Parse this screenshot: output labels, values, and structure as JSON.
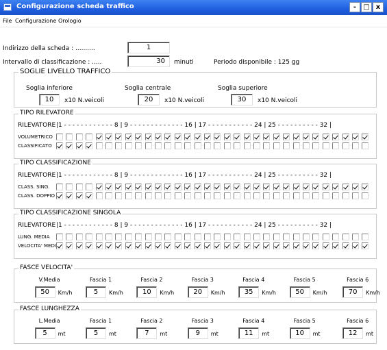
{
  "window": {
    "title": "Configurazione scheda traffico",
    "minimize": "-",
    "maximize": "□",
    "close": "x"
  },
  "menu": [
    "File",
    "Configurazione",
    "Orologio"
  ],
  "board": {
    "address_label": "Indirizzo della scheda : ..........",
    "address_value": "1",
    "interval_label": "Intervallo di classificazione : .....",
    "interval_value": "30",
    "interval_unit": "minuti",
    "period_label": "Periodo disponibile : 125 gg"
  },
  "thresholds": {
    "title": "SOGLIE LIVELLO TRAFFICO",
    "items": [
      {
        "label": "Soglia inferiore",
        "value": "10",
        "unit": "x10 N.veicoli"
      },
      {
        "label": "Soglia centrale",
        "value": "20",
        "unit": "x10 N.veicoli"
      },
      {
        "label": "Soglia superiore",
        "value": "30",
        "unit": "x10 N.veicoli"
      }
    ]
  },
  "scale_text": "|1 - - - - - - - - - - - - 8 | 9 - - - - - - - - - - - - - 16 | 17 - - - - - - - - - - - 24 | 25 - - - - - - - - - - 32 |",
  "sensor_groups": [
    {
      "title": "TIPO RILEVATORE",
      "header": "RILEVATORE",
      "rows": [
        {
          "label": "VOLUMETRICO",
          "checked": [
            false,
            false,
            false,
            false,
            true,
            true,
            true,
            true,
            true,
            true,
            true,
            true,
            true,
            true,
            true,
            true,
            true,
            true,
            true,
            true,
            true,
            true,
            true,
            true,
            true,
            true,
            true,
            true,
            true,
            true,
            true,
            true
          ]
        },
        {
          "label": "CLASSIFICATO",
          "checked": [
            true,
            true,
            true,
            true,
            false,
            false,
            false,
            false,
            false,
            false,
            false,
            false,
            false,
            false,
            false,
            false,
            false,
            false,
            false,
            false,
            false,
            false,
            false,
            false,
            false,
            false,
            false,
            false,
            false,
            false,
            false,
            false
          ]
        }
      ]
    },
    {
      "title": "TIPO CLASSIFICAZIONE",
      "header": "RILEVATORE",
      "rows": [
        {
          "label": "CLASS. SING.",
          "checked": [
            false,
            false,
            false,
            false,
            true,
            true,
            true,
            true,
            true,
            true,
            true,
            true,
            true,
            true,
            true,
            true,
            true,
            true,
            true,
            true,
            true,
            true,
            true,
            true,
            true,
            true,
            true,
            true,
            true,
            true,
            true,
            true
          ]
        },
        {
          "label": "CLASS. DOPPIO",
          "checked": [
            true,
            true,
            true,
            true,
            false,
            false,
            false,
            false,
            false,
            false,
            false,
            false,
            false,
            false,
            false,
            false,
            false,
            false,
            false,
            false,
            false,
            false,
            false,
            false,
            false,
            false,
            false,
            false,
            false,
            false,
            false,
            false
          ]
        }
      ]
    },
    {
      "title": "TIPO CLASSIFICAZIONE SINGOLA",
      "header": "RILEVATORE",
      "rows": [
        {
          "label": "LUNG. MEDIA",
          "checked": [
            false,
            false,
            false,
            false,
            false,
            false,
            false,
            false,
            false,
            false,
            false,
            false,
            false,
            false,
            false,
            false,
            false,
            false,
            false,
            false,
            false,
            false,
            false,
            false,
            false,
            false,
            false,
            false,
            false,
            false,
            false,
            false
          ]
        },
        {
          "label": "VELOCITA' MEDIA",
          "checked": [
            true,
            true,
            true,
            true,
            true,
            true,
            true,
            true,
            true,
            true,
            true,
            true,
            true,
            true,
            true,
            true,
            true,
            true,
            true,
            true,
            true,
            true,
            true,
            true,
            true,
            true,
            true,
            true,
            true,
            true,
            true,
            true
          ]
        }
      ]
    }
  ],
  "speed_bands": {
    "title": "FASCE VELOCITA'",
    "items": [
      {
        "label": "V.Media",
        "value": "50",
        "unit": "Km/h"
      },
      {
        "label": "Fascia 1",
        "value": "5",
        "unit": "Km/h"
      },
      {
        "label": "Fascia 2",
        "value": "10",
        "unit": "Km/h"
      },
      {
        "label": "Fascia 3",
        "value": "20",
        "unit": "Km/h"
      },
      {
        "label": "Fascia 4",
        "value": "35",
        "unit": "Km/h"
      },
      {
        "label": "Fascia 5",
        "value": "50",
        "unit": "Km/h"
      },
      {
        "label": "Fascia 6",
        "value": "70",
        "unit": "Km/h"
      }
    ]
  },
  "length_bands": {
    "title": "FASCE LUNGHEZZA",
    "items": [
      {
        "label": "L.Media",
        "value": "5",
        "unit": "mt"
      },
      {
        "label": "Fascia 1",
        "value": "5",
        "unit": "mt"
      },
      {
        "label": "Fascia 2",
        "value": "7",
        "unit": "mt"
      },
      {
        "label": "Fascia 3",
        "value": "9",
        "unit": "mt"
      },
      {
        "label": "Fascia 4",
        "value": "11",
        "unit": "mt"
      },
      {
        "label": "Fascia 5",
        "value": "10",
        "unit": "mt"
      },
      {
        "label": "Fascia 6",
        "value": "12",
        "unit": "mt"
      }
    ]
  }
}
